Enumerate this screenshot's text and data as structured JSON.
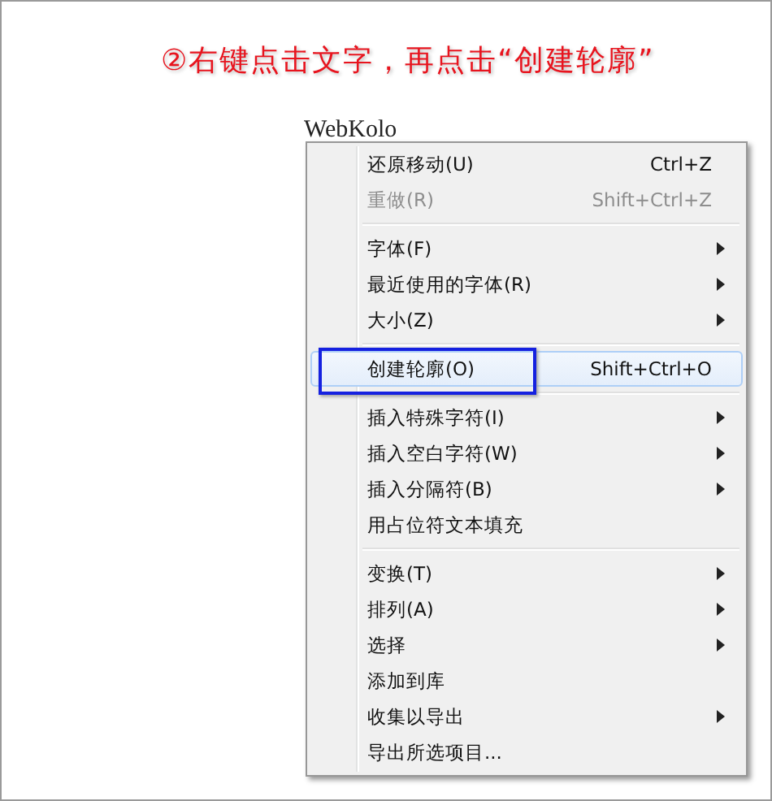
{
  "caption": "②右键点击文字，再点击“创建轮廓”",
  "canvas_text": "WebKolo",
  "context_menu": {
    "items": [
      {
        "kind": "item",
        "label": "还原移动(U)",
        "shortcut": "Ctrl+Z",
        "submenu": false,
        "disabled": false,
        "selected": false,
        "annotated": false
      },
      {
        "kind": "item",
        "label": "重做(R)",
        "shortcut": "Shift+Ctrl+Z",
        "submenu": false,
        "disabled": true,
        "selected": false,
        "annotated": false
      },
      {
        "kind": "separator"
      },
      {
        "kind": "item",
        "label": "字体(F)",
        "submenu": true,
        "disabled": false,
        "selected": false,
        "annotated": false
      },
      {
        "kind": "item",
        "label": "最近使用的字体(R)",
        "submenu": true,
        "disabled": false,
        "selected": false,
        "annotated": false
      },
      {
        "kind": "item",
        "label": "大小(Z)",
        "submenu": true,
        "disabled": false,
        "selected": false,
        "annotated": false
      },
      {
        "kind": "separator"
      },
      {
        "kind": "item",
        "label": "创建轮廓(O)",
        "shortcut": "Shift+Ctrl+O",
        "submenu": false,
        "disabled": false,
        "selected": true,
        "annotated": true
      },
      {
        "kind": "separator"
      },
      {
        "kind": "item",
        "label": "插入特殊字符(I)",
        "submenu": true,
        "disabled": false,
        "selected": false,
        "annotated": false
      },
      {
        "kind": "item",
        "label": "插入空白字符(W)",
        "submenu": true,
        "disabled": false,
        "selected": false,
        "annotated": false
      },
      {
        "kind": "item",
        "label": "插入分隔符(B)",
        "submenu": true,
        "disabled": false,
        "selected": false,
        "annotated": false
      },
      {
        "kind": "item",
        "label": "用占位符文本填充",
        "submenu": false,
        "disabled": false,
        "selected": false,
        "annotated": false
      },
      {
        "kind": "separator"
      },
      {
        "kind": "item",
        "label": "变换(T)",
        "submenu": true,
        "disabled": false,
        "selected": false,
        "annotated": false
      },
      {
        "kind": "item",
        "label": "排列(A)",
        "submenu": true,
        "disabled": false,
        "selected": false,
        "annotated": false
      },
      {
        "kind": "item",
        "label": "选择",
        "submenu": true,
        "disabled": false,
        "selected": false,
        "annotated": false
      },
      {
        "kind": "item",
        "label": "添加到库",
        "submenu": false,
        "disabled": false,
        "selected": false,
        "annotated": false
      },
      {
        "kind": "item",
        "label": "收集以导出",
        "submenu": true,
        "disabled": false,
        "selected": false,
        "annotated": false
      },
      {
        "kind": "item",
        "label": "导出所选项目...",
        "submenu": false,
        "disabled": false,
        "selected": false,
        "annotated": false
      }
    ]
  }
}
